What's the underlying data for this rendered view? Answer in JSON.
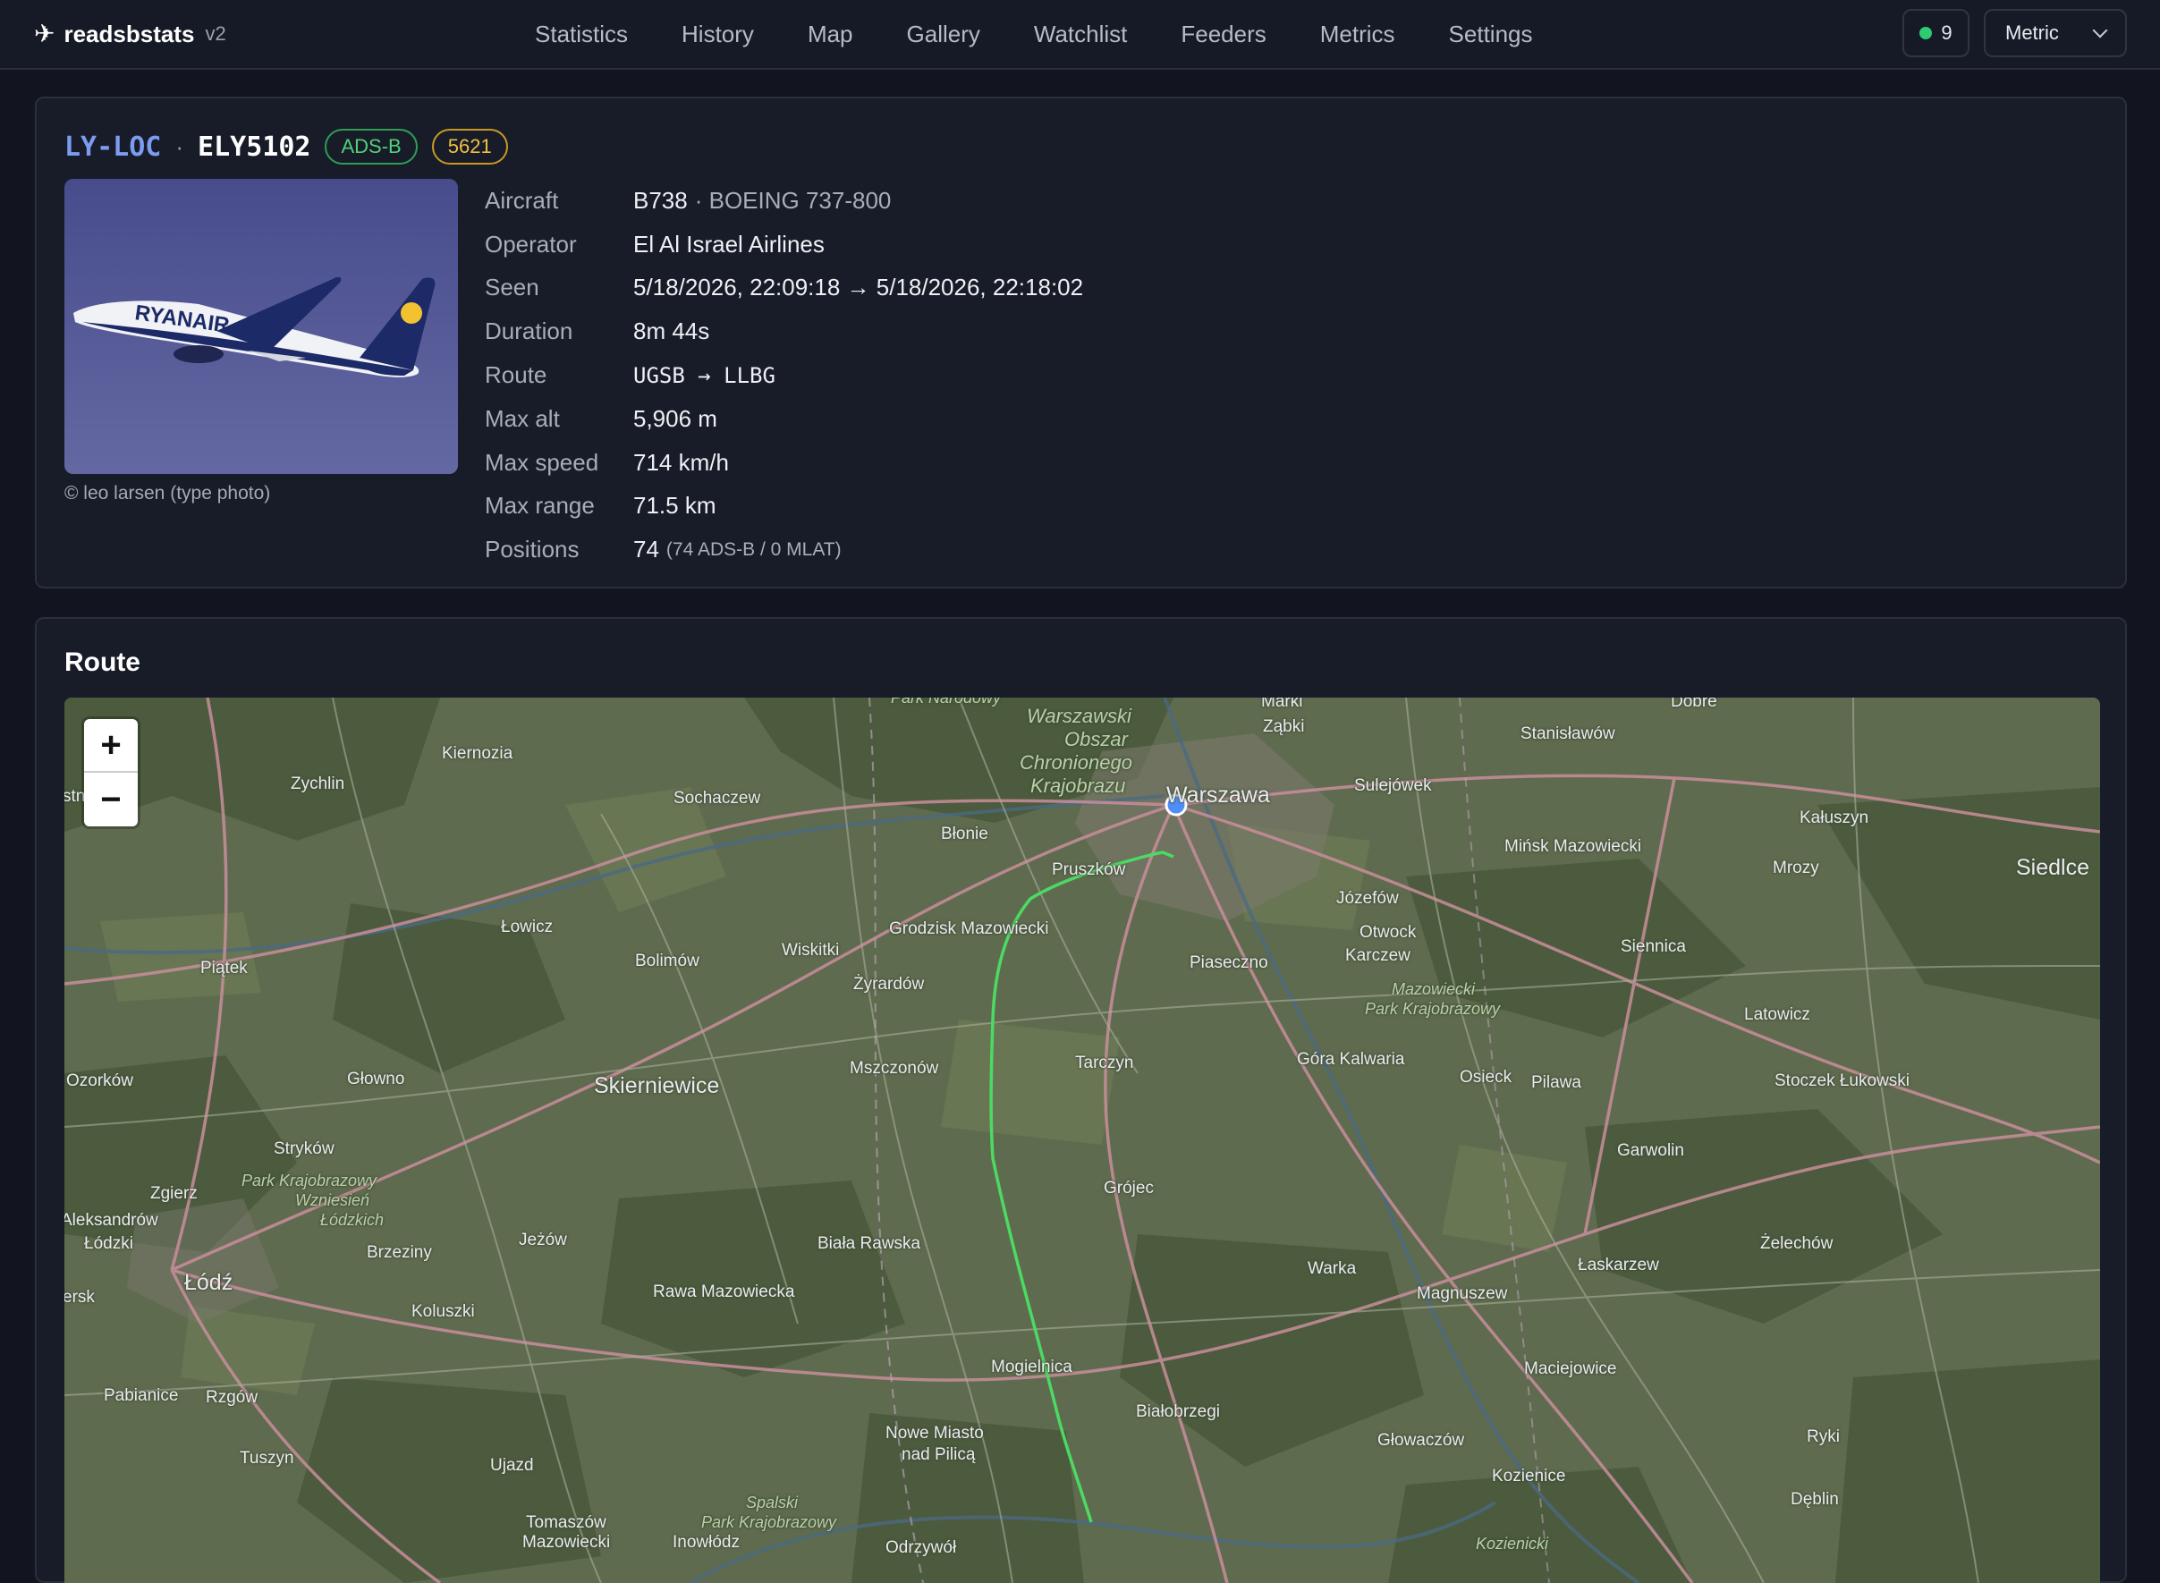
{
  "brand": {
    "name": "readsbstats",
    "version": "v2"
  },
  "nav": [
    "Statistics",
    "History",
    "Map",
    "Gallery",
    "Watchlist",
    "Feeders",
    "Metrics",
    "Settings"
  ],
  "status": {
    "count": "9",
    "color": "#2ecc71"
  },
  "units": {
    "selected": "Metric"
  },
  "flight": {
    "registration": "LY-LOC",
    "separator": "·",
    "callsign": "ELY5102",
    "source_badge": "ADS-B",
    "squawk": "5621",
    "photo_credit": "© leo larsen (type photo)",
    "photo_livery_text": "RYANAIR",
    "details": {
      "aircraft_label": "Aircraft",
      "aircraft_type": "B738",
      "aircraft_model": "· BOEING 737-800",
      "operator_label": "Operator",
      "operator": "El Al Israel Airlines",
      "seen_label": "Seen",
      "seen": "5/18/2026, 22:09:18 → 5/18/2026, 22:18:02",
      "duration_label": "Duration",
      "duration": "8m 44s",
      "route_label": "Route",
      "route": "UGSB → LLBG",
      "max_alt_label": "Max alt",
      "max_alt": "5,906 m",
      "max_speed_label": "Max speed",
      "max_speed": "714 km/h",
      "max_range_label": "Max range",
      "max_range": "71.5 km",
      "positions_label": "Positions",
      "positions": "74",
      "positions_breakdown": "(74 ADS-B / 0 MLAT)"
    }
  },
  "route_map": {
    "title": "Route",
    "zoom_in": "+",
    "zoom_out": "−",
    "track_color": "#4cd964",
    "receiver_color": "#4f8df7",
    "places": {
      "warszawa": "Warszawa",
      "kiernozia": "Kiernozia",
      "zychlin": "Zychlin",
      "sochaczew": "Sochaczew",
      "blonie": "Błonie",
      "pruszkow": "Pruszków",
      "zabki": "Ząbki",
      "sulejowek": "Sulejówek",
      "stanislawow": "Stanisławów",
      "dobre": "Dobre",
      "kaluszyn": "Kałuszyn",
      "minsk": "Mińsk Mazowiecki",
      "mrozy": "Mrozy",
      "siedlce": "Siedlce",
      "lowicz": "Łowicz",
      "piatek": "Piątek",
      "bolimow": "Bolimów",
      "wiskitki": "Wiskitki",
      "grodzisk": "Grodzisk Mazowiecki",
      "zyrardow": "Żyrardów",
      "piaseczno": "Piaseczno",
      "jozefow": "Józefów",
      "otwock": "Otwock",
      "karczew": "Karczew",
      "siennica": "Siennica",
      "latowicz": "Latowicz",
      "ozorkow": "Ozorków",
      "glowno": "Głowno",
      "skierniewice": "Skierniewice",
      "mszczonow": "Mszczonów",
      "tarczyn": "Tarczyn",
      "gora_kalwaria": "Góra Kalwaria",
      "osieck": "Osieck",
      "pilawa": "Pilawa",
      "stoczek": "Stoczek Łukowski",
      "strykow": "Stryków",
      "zgierz": "Zgierz",
      "aleksandrow": "Aleksandrów",
      "lodzki": "Łódzki",
      "lodz": "Łódź",
      "brzeziny": "Brzeziny",
      "jezow": "Jeżów",
      "koluszki": "Koluszki",
      "biala_rawska": "Biała Rawska",
      "rawa": "Rawa Mazowiecka",
      "grojec": "Grójec",
      "warka": "Warka",
      "garwolin": "Garwolin",
      "laskarzew": "Łaskarzew",
      "zelechow": "Żelechów",
      "magnuszew": "Magnuszew",
      "mogielnica": "Mogielnica",
      "bialobrzegi": "Białobrzegi",
      "maciejowice": "Maciejowice",
      "pabianice": "Pabianice",
      "rzgow": "Rzgów",
      "tuszyn": "Tuszyn",
      "ujazd": "Ujazd",
      "nowe_miasto": "Nowe Miasto",
      "nad_pilica": "nad Pilicą",
      "glowaczow": "Głowaczów",
      "kozienice": "Kozienice",
      "ryki": "Ryki",
      "deblin": "Dęblin",
      "tomaszow": "Tomaszów",
      "mazowiecki": "Mazowiecki",
      "inowlodz": "Inowłódz",
      "odrzywol": "Odrzywół",
      "ersk": "ersk",
      "stno": "stno",
      "marki": "Marki",
      "park_narodowy": "Park Narodowy",
      "warszawski": "Warszawski",
      "obszar": "Obszar",
      "chronionego": "Chronionego",
      "krajobrazu": "Krajobrazu",
      "mazowiecki_park": "Mazowiecki",
      "park_krajobrazowy": "Park Krajobrazowy",
      "pk_wzniesien": "Park Krajobrazowy",
      "wzniesien": "Wzniesień",
      "lodzkich": "Łódzkich",
      "spalski": "Spalski",
      "spalski_pk": "Park Krajobrazowy",
      "kozienicki": "Kozienicki"
    }
  }
}
